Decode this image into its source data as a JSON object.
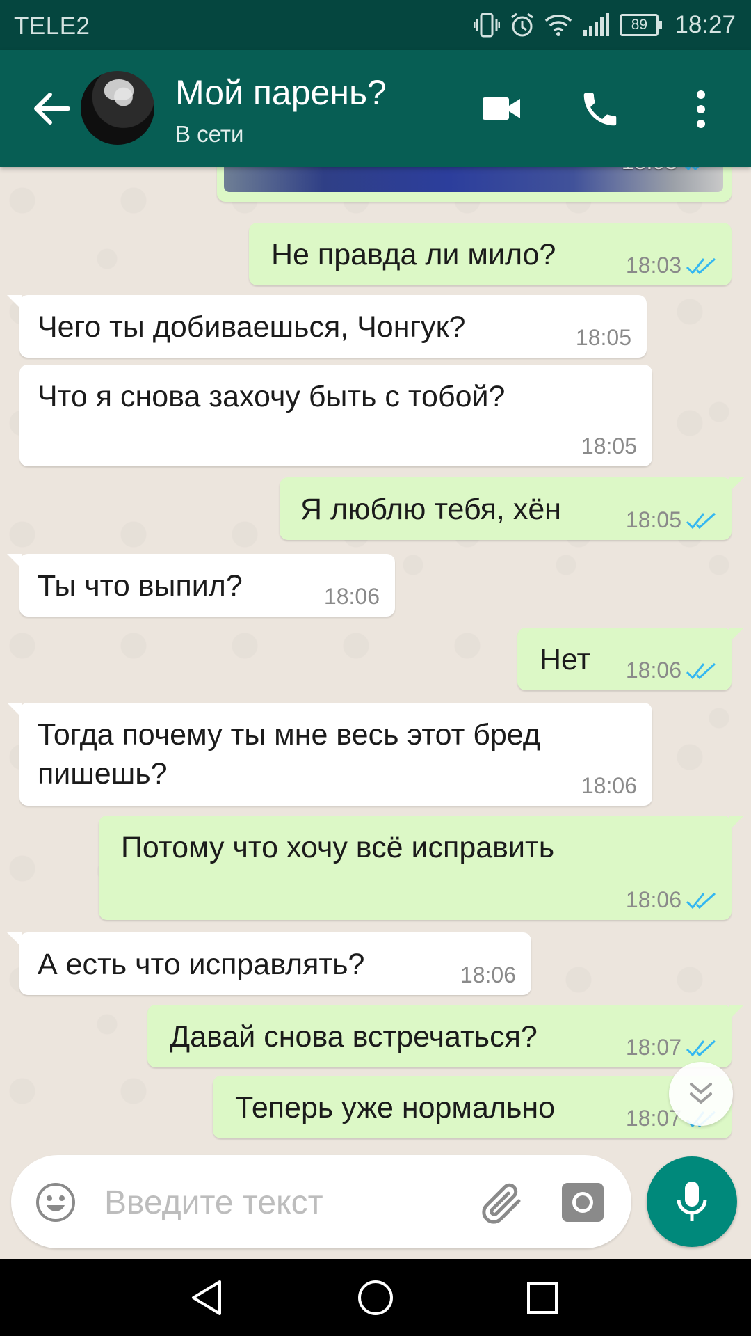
{
  "status_bar": {
    "carrier": "TELE2",
    "battery": "89",
    "time": "18:27"
  },
  "header": {
    "contact_name": "Мой парень?",
    "contact_status": "В сети"
  },
  "image_message": {
    "time": "18:03",
    "read": true
  },
  "messages": [
    {
      "dir": "out",
      "text": "Не правда ли мило?",
      "time": "18:03"
    },
    {
      "dir": "in",
      "text": "Чего ты добиваешься, Чонгук?",
      "time": "18:05"
    },
    {
      "dir": "in",
      "text": "Что я снова захочу быть с тобой?",
      "time": "18:05"
    },
    {
      "dir": "out",
      "text": "Я люблю тебя, хён",
      "time": "18:05"
    },
    {
      "dir": "in",
      "text": "Ты что выпил?",
      "time": "18:06"
    },
    {
      "dir": "out",
      "text": "Нет",
      "time": "18:06"
    },
    {
      "dir": "in",
      "text": "Тогда почему ты мне весь этот бред",
      "text2": "пишешь?",
      "time": "18:06"
    },
    {
      "dir": "out",
      "text": "Потому что хочу всё исправить",
      "time": "18:06"
    },
    {
      "dir": "in",
      "text": "А есть что исправлять?",
      "time": "18:06"
    },
    {
      "dir": "out",
      "text": "Давай снова встречаться?",
      "time": "18:07"
    },
    {
      "dir": "out",
      "text": "Теперь уже нормально",
      "time": "18:07"
    }
  ],
  "input": {
    "placeholder": "Введите текст",
    "value": ""
  },
  "colors": {
    "header": "#075e54",
    "status_bar": "#05463f",
    "outgoing": "#dcf8c6",
    "incoming": "#ffffff",
    "read_ticks": "#34b7f1",
    "mic": "#00897b"
  },
  "icons": [
    "back-arrow-icon",
    "video-call-icon",
    "phone-icon",
    "more-vert-icon",
    "emoji-icon",
    "attach-icon",
    "camera-icon",
    "mic-icon",
    "scroll-down-icon"
  ]
}
